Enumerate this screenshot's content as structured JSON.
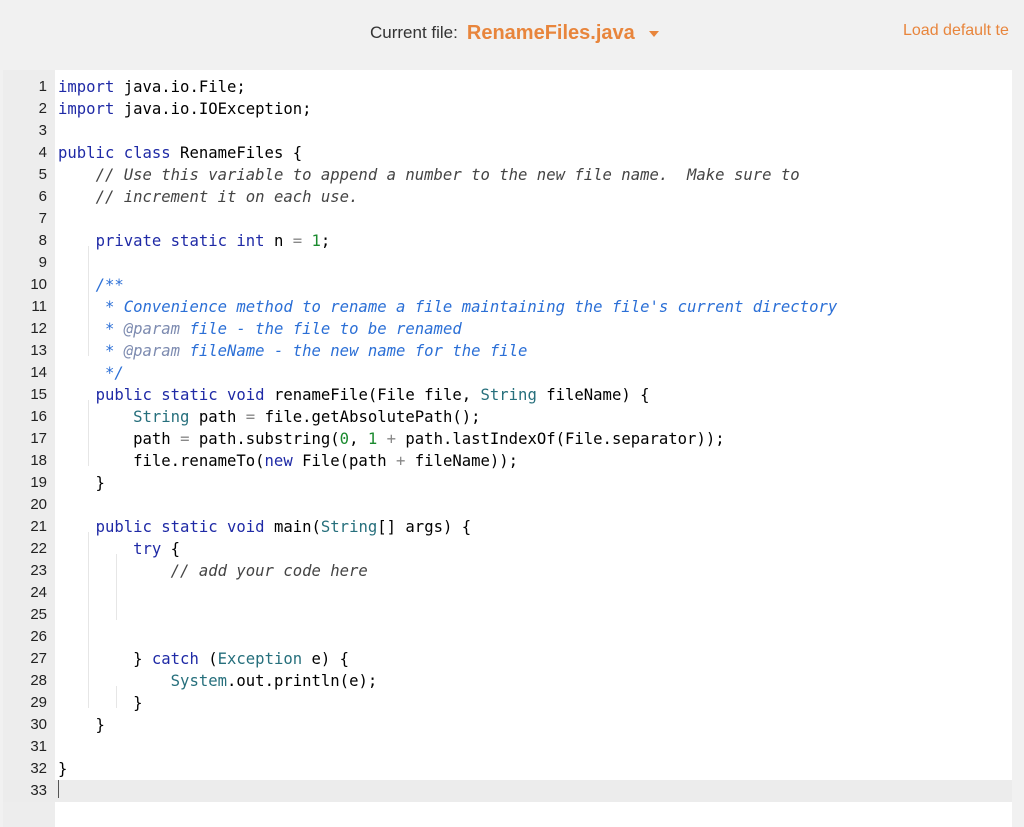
{
  "header": {
    "file_label": "Current file:",
    "file_name": "RenameFiles.java",
    "load_default_label": "Load default te"
  },
  "editor": {
    "language": "java",
    "active_line": 33,
    "lines": [
      [
        {
          "t": "import",
          "c": "kw"
        },
        {
          "t": " java.io.File;"
        }
      ],
      [
        {
          "t": "import",
          "c": "kw"
        },
        {
          "t": " java.io.IOException;"
        }
      ],
      [],
      [
        {
          "t": "public class",
          "c": "kw"
        },
        {
          "t": " RenameFiles {"
        }
      ],
      [
        {
          "t": "    "
        },
        {
          "t": "// Use this variable to append a number to the new file name.  Make sure to",
          "c": "cm"
        }
      ],
      [
        {
          "t": "    "
        },
        {
          "t": "// increment it on each use.",
          "c": "cm"
        }
      ],
      [],
      [
        {
          "t": "    "
        },
        {
          "t": "private static int",
          "c": "kw"
        },
        {
          "t": " n "
        },
        {
          "t": "=",
          "c": "op"
        },
        {
          "t": " "
        },
        {
          "t": "1",
          "c": "nm"
        },
        {
          "t": ";"
        }
      ],
      [],
      [
        {
          "t": "    "
        },
        {
          "t": "/**",
          "c": "dc"
        }
      ],
      [
        {
          "t": "     "
        },
        {
          "t": "* Convenience method to rename a file maintaining the file's current directory",
          "c": "dc"
        }
      ],
      [
        {
          "t": "     "
        },
        {
          "t": "* ",
          "c": "dc"
        },
        {
          "t": "@param",
          "c": "da"
        },
        {
          "t": " file - the file to be renamed",
          "c": "dc"
        }
      ],
      [
        {
          "t": "     "
        },
        {
          "t": "* ",
          "c": "dc"
        },
        {
          "t": "@param",
          "c": "da"
        },
        {
          "t": " fileName - the new name for the file",
          "c": "dc"
        }
      ],
      [
        {
          "t": "     "
        },
        {
          "t": "*/",
          "c": "dc"
        }
      ],
      [
        {
          "t": "    "
        },
        {
          "t": "public static void",
          "c": "kw"
        },
        {
          "t": " renameFile(File file, "
        },
        {
          "t": "String",
          "c": "ty"
        },
        {
          "t": " fileName) {"
        }
      ],
      [
        {
          "t": "        "
        },
        {
          "t": "String",
          "c": "ty"
        },
        {
          "t": " path "
        },
        {
          "t": "=",
          "c": "op"
        },
        {
          "t": " file.getAbsolutePath();"
        }
      ],
      [
        {
          "t": "        path "
        },
        {
          "t": "=",
          "c": "op"
        },
        {
          "t": " path.substring("
        },
        {
          "t": "0",
          "c": "nm"
        },
        {
          "t": ", "
        },
        {
          "t": "1",
          "c": "nm"
        },
        {
          "t": " "
        },
        {
          "t": "+",
          "c": "op"
        },
        {
          "t": " path.lastIndexOf(File.separator));"
        }
      ],
      [
        {
          "t": "        file.renameTo("
        },
        {
          "t": "new",
          "c": "kw"
        },
        {
          "t": " File(path "
        },
        {
          "t": "+",
          "c": "op"
        },
        {
          "t": " fileName));"
        }
      ],
      [
        {
          "t": "    }"
        }
      ],
      [],
      [
        {
          "t": "    "
        },
        {
          "t": "public static void",
          "c": "kw"
        },
        {
          "t": " main("
        },
        {
          "t": "String",
          "c": "ty"
        },
        {
          "t": "[] args) {"
        }
      ],
      [
        {
          "t": "        "
        },
        {
          "t": "try",
          "c": "kw"
        },
        {
          "t": " {"
        }
      ],
      [
        {
          "t": "            "
        },
        {
          "t": "// add your code here",
          "c": "cm"
        }
      ],
      [],
      [],
      [],
      [
        {
          "t": "        } "
        },
        {
          "t": "catch",
          "c": "kw"
        },
        {
          "t": " ("
        },
        {
          "t": "Exception",
          "c": "ty"
        },
        {
          "t": " e) {"
        }
      ],
      [
        {
          "t": "            "
        },
        {
          "t": "System",
          "c": "ty"
        },
        {
          "t": ".out.println(e);"
        }
      ],
      [
        {
          "t": "        }"
        }
      ],
      [
        {
          "t": "    }"
        }
      ],
      [],
      [
        {
          "t": "}"
        }
      ],
      []
    ]
  }
}
